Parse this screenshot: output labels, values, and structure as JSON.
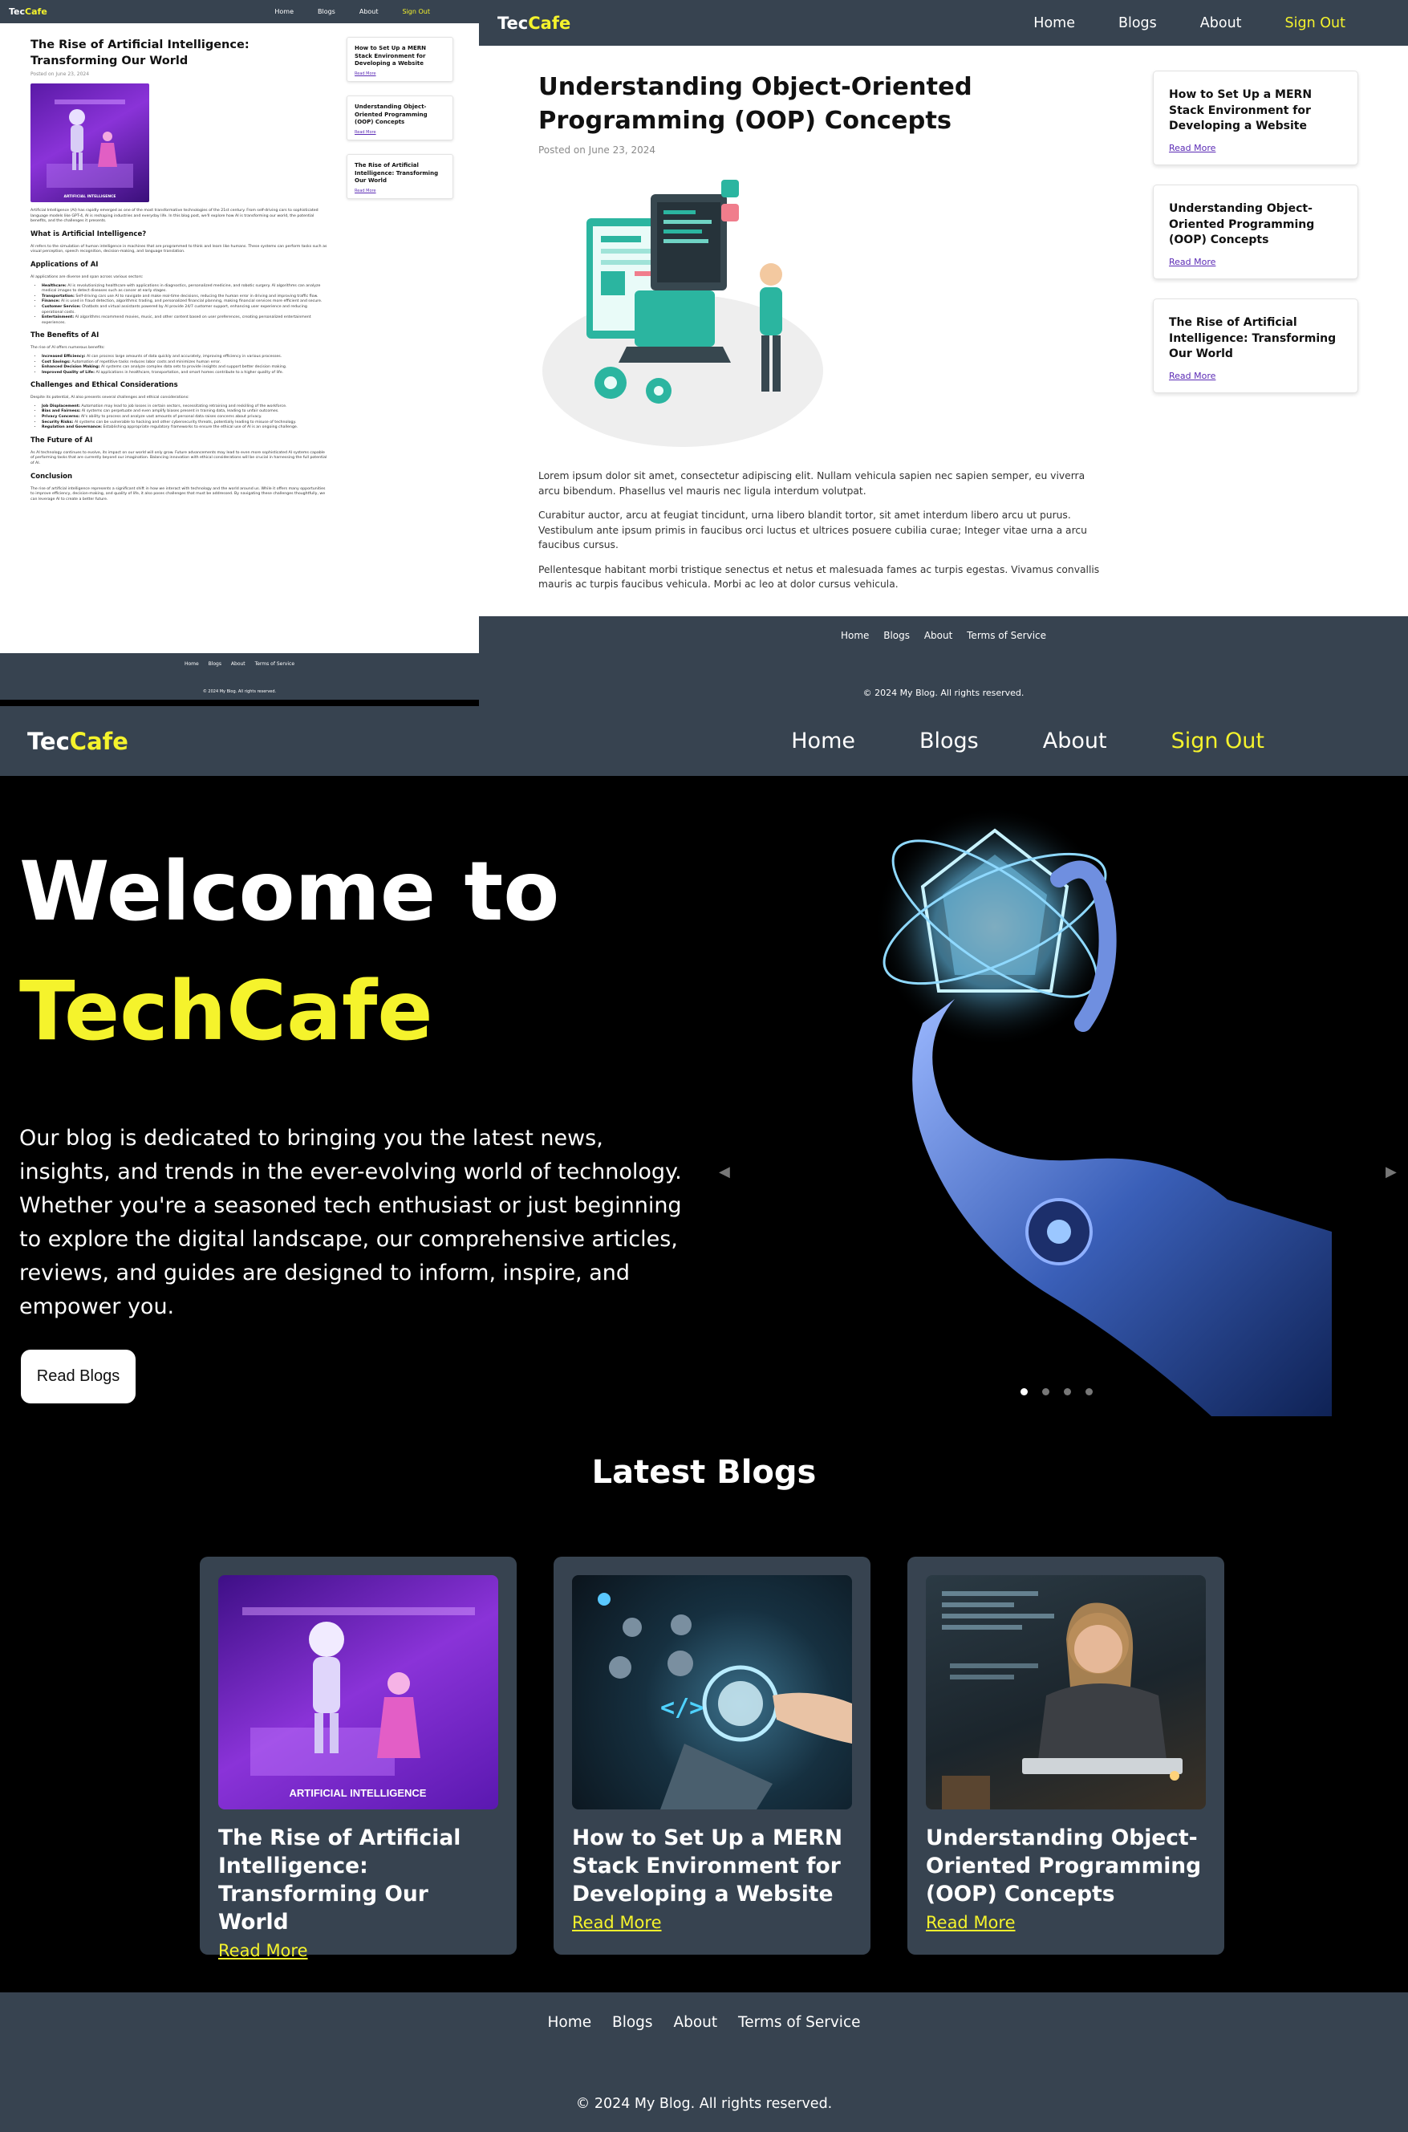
{
  "brand": {
    "prefix": "Tec",
    "suffix": "Cafe"
  },
  "nav": {
    "home": "Home",
    "blogs": "Blogs",
    "about": "About",
    "sign_out": "Sign Out"
  },
  "colors": {
    "navbar": "#374350",
    "accent": "#f5f32c",
    "background_dark": "#000000",
    "link_purple": "#5b2bb5"
  },
  "footer": {
    "links": [
      "Home",
      "Blogs",
      "About",
      "Terms of Service"
    ],
    "copyright": "© 2024 My Blog. All rights reserved."
  },
  "sidebar_posts": [
    {
      "title": "How to Set Up a MERN Stack Environment for Developing a Website",
      "link": "Read More"
    },
    {
      "title": "Understanding Object-Oriented Programming (OOP) Concepts",
      "link": "Read More"
    },
    {
      "title": "The Rise of Artificial Intelligence: Transforming Our World",
      "link": "Read More"
    }
  ],
  "ai_article": {
    "title": "The Rise of Artificial Intelligence: Transforming Our World",
    "date": "Posted on June 23, 2024",
    "image_caption": "ARTIFICIAL INTELLIGENCE",
    "intro": "Artificial Intelligence (AI) has rapidly emerged as one of the most transformative technologies of the 21st century. From self-driving cars to sophisticated language models like GPT-4, AI is reshaping industries and everyday life. In this blog post, we'll explore how AI is transforming our world, the potential benefits, and the challenges it presents.",
    "s1_heading": "What is Artificial Intelligence?",
    "s1_text": "AI refers to the simulation of human intelligence in machines that are programmed to think and learn like humans. These systems can perform tasks such as visual perception, speech recognition, decision-making, and language translation.",
    "s2_heading": "Applications of AI",
    "s2_text": "AI applications are diverse and span across various sectors:",
    "s2_items": [
      {
        "label": "Healthcare:",
        "text": "AI is revolutionizing healthcare with applications in diagnostics, personalized medicine, and robotic surgery. AI algorithms can analyze medical images to detect diseases such as cancer at early stages."
      },
      {
        "label": "Transportation:",
        "text": "Self-driving cars use AI to navigate and make real-time decisions, reducing the human error in driving and improving traffic flow."
      },
      {
        "label": "Finance:",
        "text": "AI is used in fraud detection, algorithmic trading, and personalized financial planning, making financial services more efficient and secure."
      },
      {
        "label": "Customer Service:",
        "text": "Chatbots and virtual assistants powered by AI provide 24/7 customer support, enhancing user experience and reducing operational costs."
      },
      {
        "label": "Entertainment:",
        "text": "AI algorithms recommend movies, music, and other content based on user preferences, creating personalized entertainment experiences."
      }
    ],
    "s3_heading": "The Benefits of AI",
    "s3_text": "The rise of AI offers numerous benefits:",
    "s3_items": [
      {
        "label": "Increased Efficiency:",
        "text": "AI can process large amounts of data quickly and accurately, improving efficiency in various processes."
      },
      {
        "label": "Cost Savings:",
        "text": "Automation of repetitive tasks reduces labor costs and minimizes human error."
      },
      {
        "label": "Enhanced Decision Making:",
        "text": "AI systems can analyze complex data sets to provide insights and support better decision making."
      },
      {
        "label": "Improved Quality of Life:",
        "text": "AI applications in healthcare, transportation, and smart homes contribute to a higher quality of life."
      }
    ],
    "s4_heading": "Challenges and Ethical Considerations",
    "s4_text": "Despite its potential, AI also presents several challenges and ethical considerations:",
    "s4_items": [
      {
        "label": "Job Displacement:",
        "text": "Automation may lead to job losses in certain sectors, necessitating retraining and reskilling of the workforce."
      },
      {
        "label": "Bias and Fairness:",
        "text": "AI systems can perpetuate and even amplify biases present in training data, leading to unfair outcomes."
      },
      {
        "label": "Privacy Concerns:",
        "text": "AI's ability to process and analyze vast amounts of personal data raises concerns about privacy."
      },
      {
        "label": "Security Risks:",
        "text": "AI systems can be vulnerable to hacking and other cybersecurity threats, potentially leading to misuse of technology."
      },
      {
        "label": "Regulation and Governance:",
        "text": "Establishing appropriate regulatory frameworks to ensure the ethical use of AI is an ongoing challenge."
      }
    ],
    "s5_heading": "The Future of AI",
    "s5_text": "As AI technology continues to evolve, its impact on our world will only grow. Future advancements may lead to even more sophisticated AI systems capable of performing tasks that are currently beyond our imagination. Balancing innovation with ethical considerations will be crucial in harnessing the full potential of AI.",
    "s6_heading": "Conclusion",
    "s6_text": "The rise of artificial intelligence represents a significant shift in how we interact with technology and the world around us. While it offers many opportunities to improve efficiency, decision-making, and quality of life, it also poses challenges that must be addressed. By navigating these challenges thoughtfully, we can leverage AI to create a better future."
  },
  "oop_article": {
    "title": "Understanding Object-Oriented Programming (OOP) Concepts",
    "date": "Posted on June 23, 2024",
    "paragraphs": [
      "Lorem ipsum dolor sit amet, consectetur adipiscing elit. Nullam vehicula sapien nec sapien semper, eu viverra arcu bibendum. Phasellus vel mauris nec ligula interdum volutpat.",
      "Curabitur auctor, arcu at feugiat tincidunt, urna libero blandit tortor, sit amet interdum libero arcu ut purus. Vestibulum ante ipsum primis in faucibus orci luctus et ultrices posuere cubilia curae; Integer vitae urna a arcu faucibus cursus.",
      "Pellentesque habitant morbi tristique senectus et netus et malesuada fames ac turpis egestas. Vivamus convallis mauris ac turpis faucibus vehicula. Morbi ac leo at dolor cursus vehicula."
    ]
  },
  "home": {
    "welcome": "Welcome to",
    "brand_name": "TechCafe",
    "intro": "Our blog is dedicated to bringing you the latest news, insights, and trends in the ever-evolving world of technology. Whether you're a seasoned tech enthusiast or just beginning to explore the digital landscape, our comprehensive articles, reviews, and guides are designed to inform, inspire, and empower you.",
    "cta": "Read Blogs",
    "carousel": {
      "slides": 4,
      "active_slide": 1
    },
    "latest_heading": "Latest Blogs",
    "cards": [
      {
        "title": "The Rise of Artificial Intelligence: Transforming Our World",
        "link": "Read More",
        "image_caption": "ARTIFICIAL INTELLIGENCE"
      },
      {
        "title": "How to Set Up a MERN Stack Environment for Developing a Website",
        "link": "Read More",
        "image_caption": ""
      },
      {
        "title": "Understanding Object-Oriented Programming (OOP) Concepts",
        "link": "Read More",
        "image_caption": ""
      }
    ]
  }
}
